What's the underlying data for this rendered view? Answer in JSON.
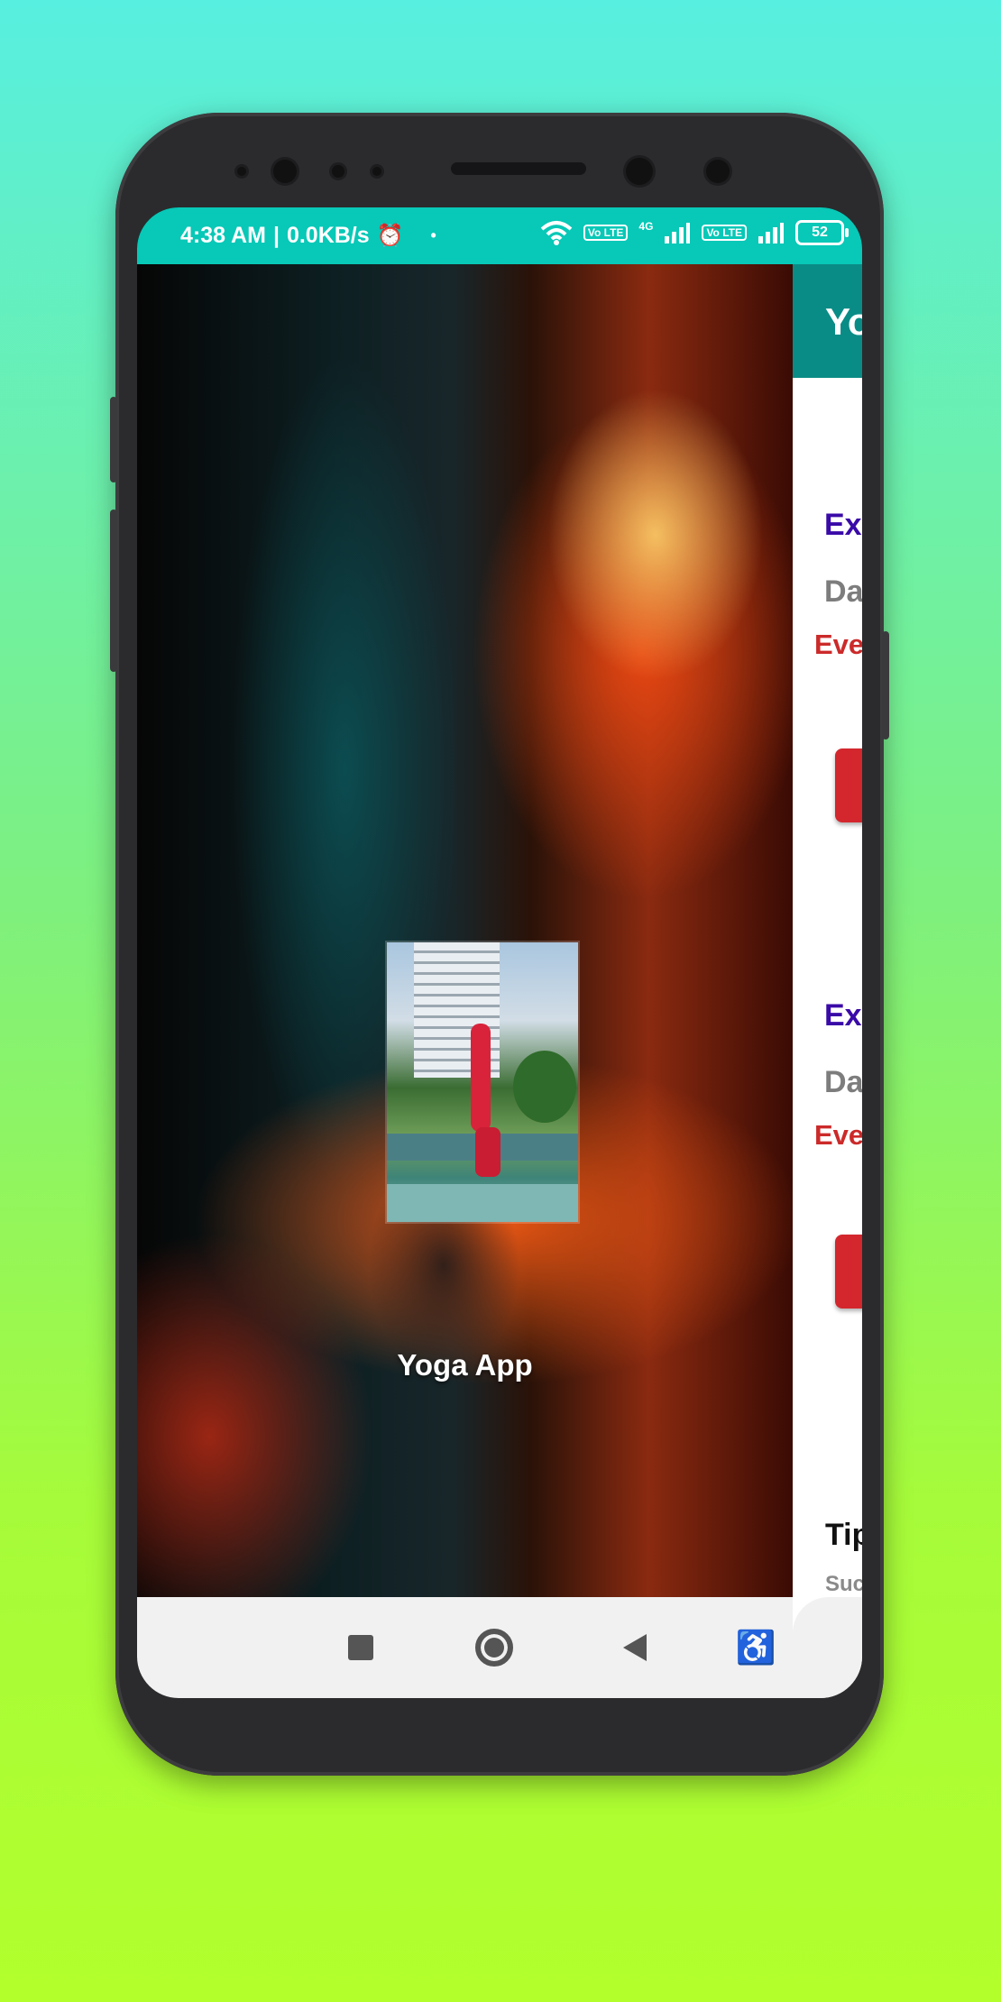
{
  "status_bar": {
    "time": "4:38 AM",
    "speed": "0.0KB/s",
    "signal_label": "4G",
    "volte_1": "Vo LTE",
    "volte_2": "Vo LTE",
    "battery": "52",
    "icons": [
      "alarm-icon",
      "dot-icon",
      "wifi-icon",
      "signal-icon",
      "battery-icon"
    ]
  },
  "splash": {
    "app_name": "Yoga App"
  },
  "panel": {
    "toolbar_title": "Yo",
    "item_1": {
      "title": "Ex",
      "subtitle": "Da",
      "tag": "Eve"
    },
    "item_2": {
      "title": "Ex",
      "subtitle": "Da",
      "tag": "Eve"
    },
    "tips_title": "Tip",
    "tips_text": "Suc"
  },
  "navigation": {
    "icons": [
      "recents-square-icon",
      "home-circle-icon",
      "back-triangle-icon",
      "accessibility-icon"
    ]
  },
  "colors": {
    "status_bar": "#08c8b7",
    "toolbar": "#0a8c86",
    "accent_red": "#d3272d",
    "title_purple": "#3a0aa8"
  }
}
